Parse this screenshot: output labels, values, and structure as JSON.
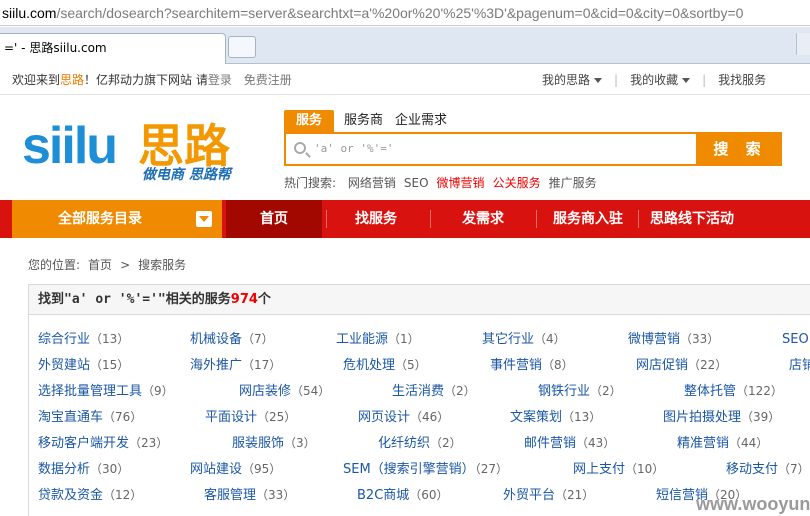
{
  "browser": {
    "url_domain": "siilu.com",
    "url_path": "/search/dosearch?searchitem=server&searchtxt=a'%20or%20'%25'%3D'&pagenum=0&cid=0&city=0&sortby=0",
    "tab_title": "=' - 思路siilu.com"
  },
  "topbar": {
    "welcome": "欢迎来到",
    "brand": "思路",
    "sub": "！亿邦动力旗下网站 请",
    "login": "登录",
    "register": "免费注册",
    "my_siilu": "我的思路",
    "favorites": "我的收藏",
    "find_service": "我找服务"
  },
  "logo": {
    "en": "siilu",
    "cn": "思路",
    "slogan": "做电商 思路帮"
  },
  "search": {
    "tabs": [
      "服务",
      "服务商",
      "企业需求"
    ],
    "value": "'a' or '%'='",
    "button": "搜 索",
    "hot_label": "热门搜索:",
    "hot": [
      {
        "t": "网络营销",
        "red": false
      },
      {
        "t": "SEO",
        "red": false
      },
      {
        "t": "微博营销",
        "red": true
      },
      {
        "t": "公关服务",
        "red": true
      },
      {
        "t": "推广服务",
        "red": false
      }
    ]
  },
  "nav": {
    "all": "全部服务目录",
    "items": [
      "首页",
      "找服务",
      "发需求",
      "服务商入驻",
      "思路线下活动"
    ]
  },
  "crumb": {
    "label": "您的位置:",
    "home": "首页",
    "sep": ">",
    "current": "搜索服务"
  },
  "results": {
    "prefix": "找到",
    "query": "\"a' or '%'='\"",
    "middle": "相关的服务",
    "count": "974",
    "suffix": "个"
  },
  "categories": [
    [
      [
        "综合行业",
        "（13）"
      ],
      [
        "机械设备",
        "（7）"
      ],
      [
        "工业能源",
        "（1）"
      ],
      [
        "其它行业",
        "（4）"
      ],
      [
        "微博营销",
        "（33）"
      ],
      [
        "SEO（",
        ""
      ]
    ],
    [
      [
        "外贸建站",
        "（15）"
      ],
      [
        "海外推广",
        "（17）"
      ],
      [
        "危机处理",
        "（5）"
      ],
      [
        "事件营销",
        "（8）"
      ],
      [
        "网店促销",
        "（22）"
      ],
      [
        "店铺",
        ""
      ]
    ],
    [
      [
        "选择批量管理工具",
        "（9）"
      ],
      [
        "网店装修",
        "（54）"
      ],
      [
        "生活消费",
        "（2）"
      ],
      [
        "钢铁行业",
        "（2）"
      ],
      [
        "整体托管",
        "（122）"
      ]
    ],
    [
      [
        "淘宝直通车",
        "（76）"
      ],
      [
        "平面设计",
        "（25）"
      ],
      [
        "网页设计",
        "（46）"
      ],
      [
        "文案策划",
        "（13）"
      ],
      [
        "图片拍摄处理",
        "（39）"
      ]
    ],
    [
      [
        "移动客户端开发",
        "（23）"
      ],
      [
        "服装服饰",
        "（3）"
      ],
      [
        "化纤纺织",
        "（2）"
      ],
      [
        "邮件营销",
        "（43）"
      ],
      [
        "精准营销",
        "（44）"
      ]
    ],
    [
      [
        "数据分析",
        "（30）"
      ],
      [
        "网站建设",
        "（95）"
      ],
      [
        "SEM（搜索引擎营销）",
        "（27）"
      ],
      [
        "网上支付",
        "（10）"
      ],
      [
        "移动支付",
        "（7）"
      ]
    ],
    [
      [
        "贷款及资金",
        "（12）"
      ],
      [
        "客服管理",
        "（33）"
      ],
      [
        "B2C商城",
        "（60）"
      ],
      [
        "外贸平台",
        "（21）"
      ],
      [
        "短信营销",
        "（20）"
      ]
    ]
  ],
  "watermark": "www.wooyun.org"
}
